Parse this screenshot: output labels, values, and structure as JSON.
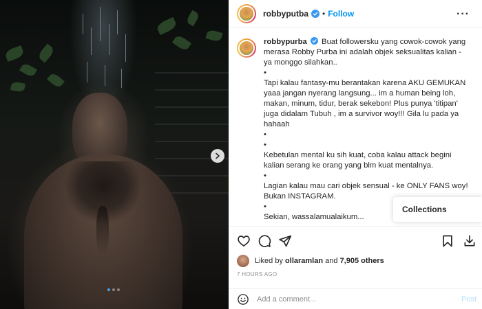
{
  "post": {
    "username": "robbyputba",
    "follow_label": "Follow",
    "separator": "•",
    "more_label": "···",
    "caption_username": "robbypurba",
    "caption_lines": [
      "Buat followersku yang cowok-cowok yang merasa Robby Purba ini adalah objek seksualitas kalian - ya monggo silahkan..",
      "•",
      "Tapi kalau fantasy-mu berantakan karena AKU GEMUKAN yaaa jangan nyerang langsung... im a human being loh, makan, minum, tidur, berak sekebon! Plus punya 'titipan' juga didalam Tubuh , im a survivor woy!!! Gila lu pada ya hahaah",
      "•",
      "•",
      "Kebetulan mental ku sih kuat, coba kalau attack begini kalian serang ke orang yang blm kuat mentalnya.",
      "•",
      "Lagian kalau mau cari objek sensual - ke ONLY FANS woy! Bukan INSTAGRAM.",
      "•",
      "Sekian, wassalamualaikum..."
    ],
    "likes_prefix": "Liked by",
    "liked_by_user": "ollaramlan",
    "likes_joiner": "and",
    "likes_count": "7,905 others",
    "timestamp": "7 HOURS AGO",
    "comment_placeholder": "Add a comment...",
    "post_button": "Post",
    "collections_label": "Collections",
    "carousel": {
      "slide_count": 3,
      "active_index": 0
    }
  },
  "icons": {
    "verified": "verified-badge-icon",
    "like": "heart-icon",
    "comment": "comment-bubble-icon",
    "share": "paper-plane-icon",
    "save": "bookmark-icon",
    "download": "download-icon",
    "emoji": "smiley-icon",
    "next": "chevron-right-icon"
  },
  "colors": {
    "link_blue": "#0095f6",
    "verified_blue": "#3897f0",
    "post_disabled": "#b2dffc",
    "muted_text": "#8e8e8e"
  }
}
